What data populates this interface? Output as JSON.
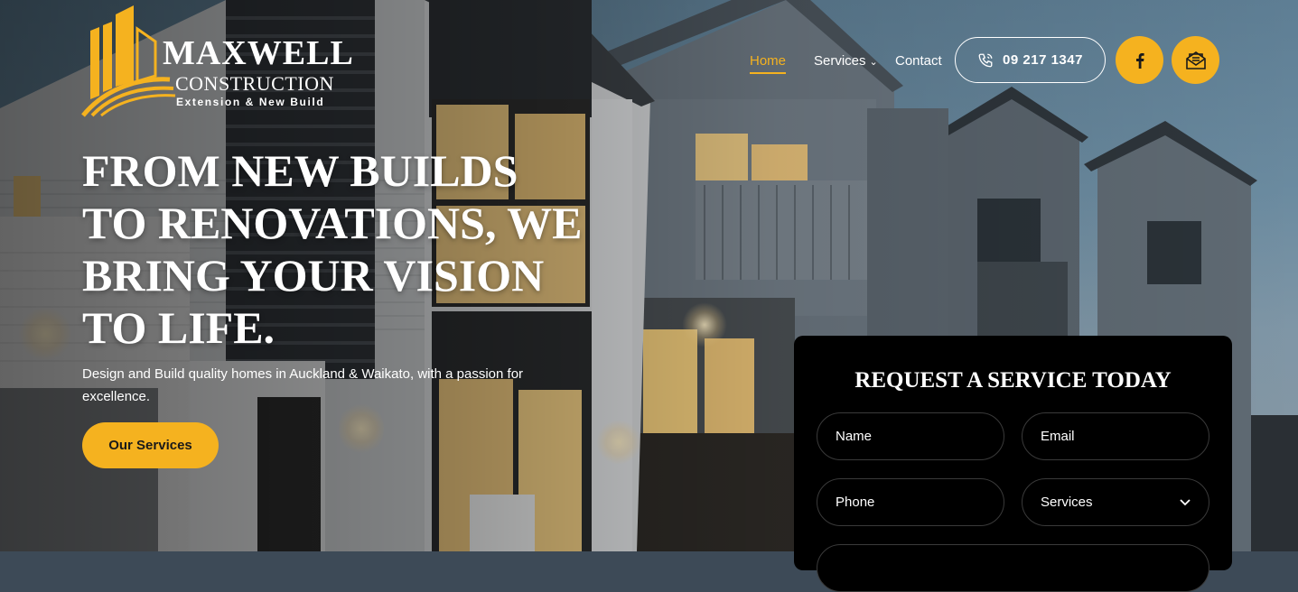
{
  "brand": {
    "name": "MAXWELL",
    "subtitle": "CONSTRUCTION",
    "tagline": "Extension & New Build",
    "accent_color": "#f5b21f"
  },
  "nav": {
    "items": [
      {
        "label": "Home",
        "active": true
      },
      {
        "label": "Services",
        "has_dropdown": true
      },
      {
        "label": "Contact"
      }
    ],
    "dropdown_icon": "chevron-down-icon"
  },
  "header_actions": {
    "phone": "09 217 1347",
    "phone_icon": "phone-icon",
    "facebook_icon": "facebook-icon",
    "mail_icon": "mail-icon"
  },
  "hero": {
    "title": "FROM NEW BUILDS TO RENOVATIONS, WE BRING YOUR VISION TO LIFE.",
    "description": "Design and Build quality homes in Auckland & Waikato, with a passion for excellence.",
    "cta_label": "Our Services"
  },
  "form": {
    "title": "REQUEST A SERVICE TODAY",
    "name_placeholder": "Name",
    "email_placeholder": "Email",
    "phone_placeholder": "Phone",
    "services_select": "Services"
  }
}
